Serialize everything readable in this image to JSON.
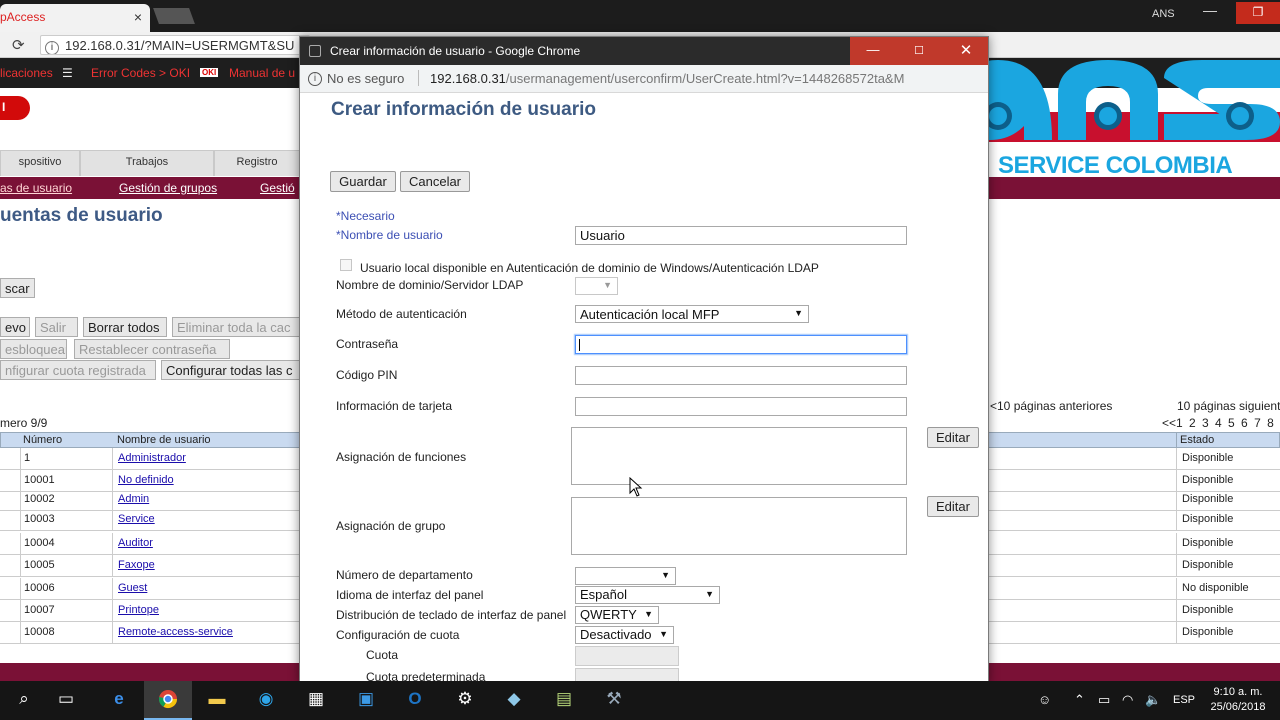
{
  "background_browser": {
    "tab_title": "pAccess",
    "tab_close": "×",
    "user": "ANS",
    "win_min": "—",
    "win_restore": "❐",
    "url": "192.168.0.31/?MAIN=USERMGMT&SU",
    "bookmarks": [
      "licaciones",
      "Error Codes > OKI",
      "Manual de u"
    ],
    "logo_text": "I",
    "nav_tabs": [
      "spositivo",
      "Trabajos",
      "Registro"
    ],
    "sub_nav": [
      "as de usuario",
      "Gestión de grupos",
      "Gestió"
    ],
    "page_title": "uentas de usuario",
    "search_button": "scar",
    "buttons_row1": [
      "evo",
      "Salir",
      "Borrar todos",
      "Eliminar toda la cac"
    ],
    "buttons_row2": [
      "esbloquear",
      "Restablecer contraseña"
    ],
    "buttons_row3": [
      "nfigurar cuota registrada",
      "Configurar todas las c"
    ],
    "count_text": "mero 9/9",
    "table_headers": [
      "Número",
      "Nombre de usuario",
      "Estado"
    ],
    "rows": [
      {
        "num": "1",
        "name": "Administrador",
        "state": "Disponible"
      },
      {
        "num": "10001",
        "name": "No definido",
        "state": "Disponible"
      },
      {
        "num": "10002",
        "name": "Admin",
        "state": "Disponible"
      },
      {
        "num": "10003",
        "name": "Service",
        "state": "Disponible"
      },
      {
        "num": "10004",
        "name": "Auditor",
        "state": "Disponible"
      },
      {
        "num": "10005",
        "name": "Faxope",
        "state": "Disponible"
      },
      {
        "num": "10006",
        "name": "Guest",
        "state": "No disponible"
      },
      {
        "num": "10007",
        "name": "Printope",
        "state": "Disponible"
      },
      {
        "num": "10008",
        "name": "Remote-access-service",
        "state": "Disponible"
      }
    ],
    "prev_pages": "<10 páginas anteriores",
    "next_pages": "10 páginas siguient",
    "page_numbers": "<<1 2 3 4 5 6 7 8"
  },
  "watermark": {
    "subtitle": "SERVICE COLOMBIA",
    "colors": {
      "cyan": "#1ba6e0",
      "dark": "#0d5f8a",
      "red": "#c8102e"
    }
  },
  "popup": {
    "title": "Crear información de usuario - Google Chrome",
    "min": "—",
    "max": "☐",
    "close": "✕",
    "security": "No es seguro",
    "url_host": "192.168.0.31",
    "url_rest": "/usermanagement/userconfirm/UserCreate.html?v=1448268572ta&M",
    "form": {
      "title": "Crear información de usuario",
      "save": "Guardar",
      "cancel": "Cancelar",
      "required": "*Necesario",
      "username_label": "*Nombre de usuario",
      "username_value": "Usuario",
      "local_user_checkbox": "Usuario local disponible en Autenticación de dominio de Windows/Autenticación LDAP",
      "domain_label": "Nombre de dominio/Servidor LDAP",
      "auth_method_label": "Método de autenticación",
      "auth_method_value": "Autenticación local MFP",
      "password_label": "Contraseña",
      "pin_label": "Código PIN",
      "card_label": "Información de tarjeta",
      "functions_label": "Asignación de funciones",
      "group_label": "Asignación de grupo",
      "edit": "Editar",
      "dept_label": "Número de departamento",
      "panel_lang_label": "Idioma de interfaz del panel",
      "panel_lang_value": "Español",
      "keyboard_label": "Distribución de teclado de interfaz de panel",
      "keyboard_value": "QWERTY",
      "quota_config_label": "Configuración de cuota",
      "quota_config_value": "Desactivado",
      "quota_label": "Cuota",
      "default_quota_label": "Cuota predeterminada"
    }
  },
  "taskbar": {
    "lang": "ESP",
    "time": "9:10 a. m.",
    "date": "25/06/2018"
  }
}
